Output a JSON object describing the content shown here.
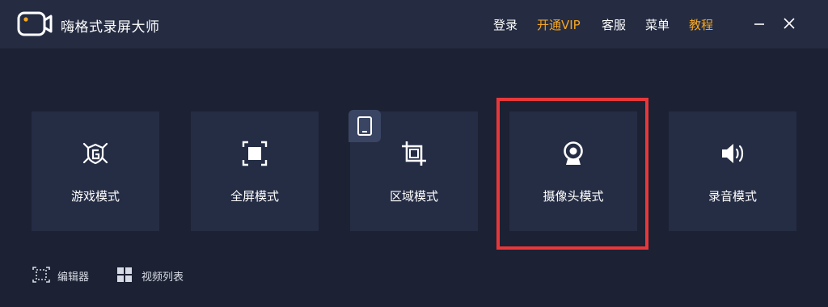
{
  "app": {
    "title": "嗨格式录屏大师"
  },
  "colors": {
    "background": "#1c2133",
    "titlebar": "#252c42",
    "card": "#252d45",
    "accent": "#f5a623",
    "highlight": "#e8373a"
  },
  "nav": {
    "login": "登录",
    "vip": "开通VIP",
    "service": "客服",
    "menu": "菜单",
    "tutorial": "教程"
  },
  "window_controls": {
    "minimize": "minimize-icon",
    "close": "close-icon"
  },
  "modes": [
    {
      "label": "游戏模式",
      "icon": "game-controller-icon"
    },
    {
      "label": "全屏模式",
      "icon": "fullscreen-icon"
    },
    {
      "label": "区域模式",
      "icon": "crop-area-icon"
    },
    {
      "label": "摄像头模式",
      "icon": "webcam-icon"
    },
    {
      "label": "录音模式",
      "icon": "speaker-icon"
    }
  ],
  "badges": {
    "region_mode": "tablet-icon"
  },
  "footer": {
    "editor": "编辑器",
    "video_list": "视频列表"
  }
}
